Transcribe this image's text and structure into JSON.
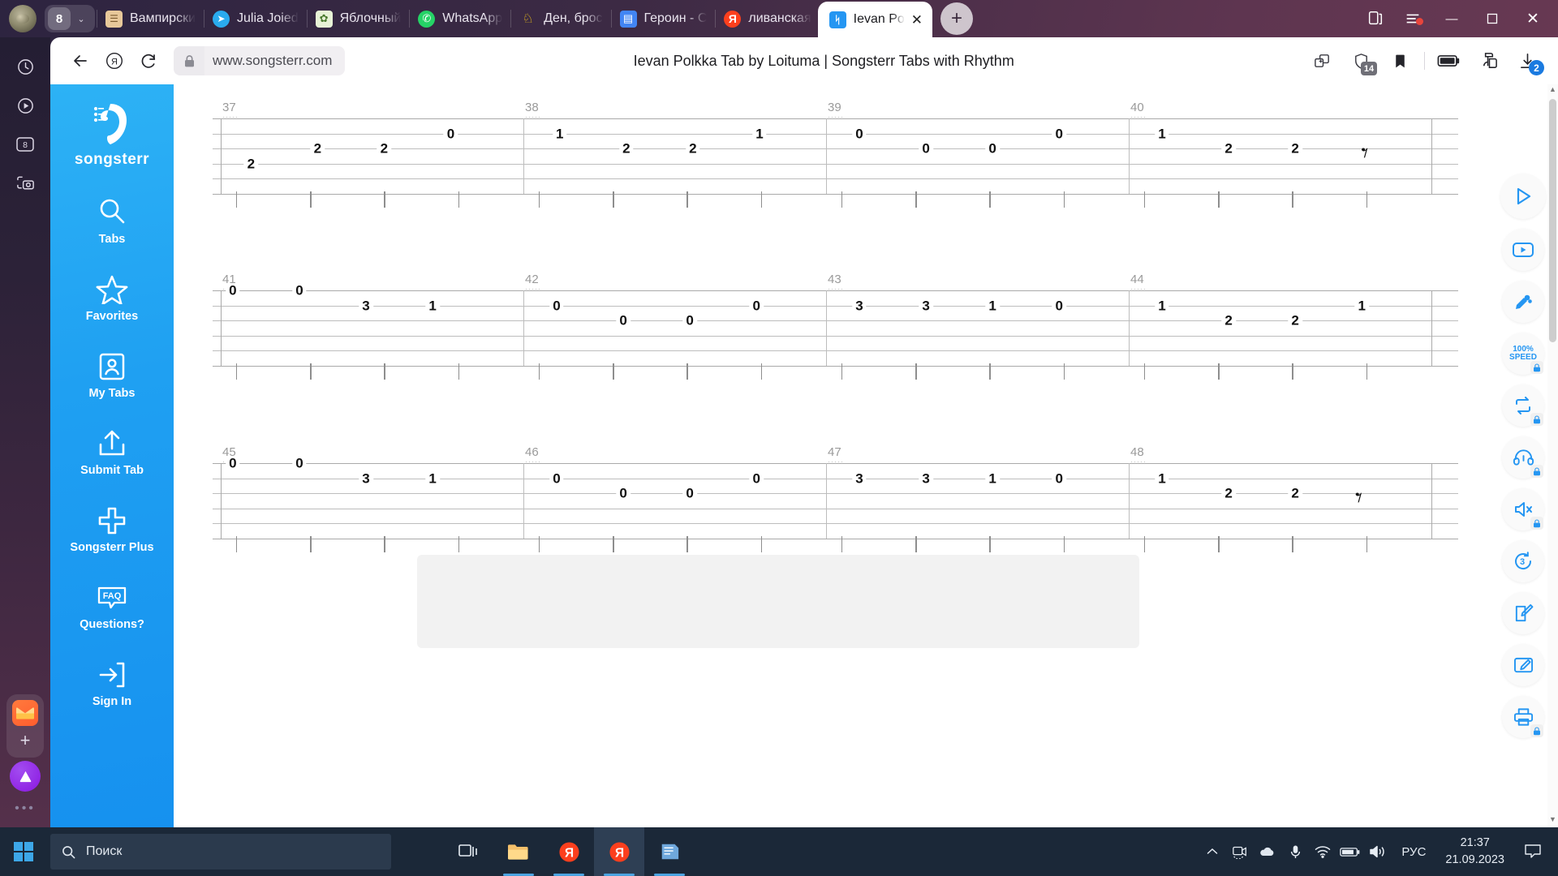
{
  "browser": {
    "session": {
      "count": "8",
      "chevron": "⌄"
    },
    "tabs": [
      {
        "title": "Вампирски",
        "icon": "burger-icon",
        "icon_char": "🍔",
        "color": "#e8c89a"
      },
      {
        "title": "Julia Joied",
        "icon": "telegram-icon",
        "icon_char": "➤",
        "color": "#2aabee"
      },
      {
        "title": "Яблочный",
        "icon": "recipe-icon",
        "icon_char": "🍏",
        "color": "#e7f2d6"
      },
      {
        "title": "WhatsApp",
        "icon": "whatsapp-icon",
        "icon_char": "✆",
        "color": "#25d366"
      },
      {
        "title": "Ден, брос",
        "icon": "fb-page-icon",
        "icon_char": "🧸",
        "color": "#f5c518"
      },
      {
        "title": "Героин - С",
        "icon": "google-docs-icon",
        "icon_char": "▤",
        "color": "#4285f4"
      },
      {
        "title": "ливанская",
        "icon": "yandex-icon",
        "icon_char": "Я",
        "color": "#fc3f1d"
      }
    ],
    "active_tab": {
      "title": "Ievan Po",
      "icon": "songsterr-icon",
      "close": "✕"
    },
    "new_tab_label": "+",
    "window_controls": {
      "minimize": "—",
      "maximize": "▢",
      "close": "✕"
    },
    "toolbar": {
      "back": "←",
      "yandex_home": "Я",
      "reload": "↻",
      "url": "www.songsterr.com",
      "page_title": "Ievan Polkka Tab by Loituma | Songsterr Tabs with Rhythm",
      "right_icons": [
        {
          "name": "split-screen-icon",
          "badge": ""
        },
        {
          "name": "shield-adblock-icon",
          "badge": "14"
        },
        {
          "name": "bookmark-icon",
          "badge": ""
        },
        {
          "name": "battery-saver-icon",
          "badge": ""
        },
        {
          "name": "profile-icon",
          "badge": ""
        },
        {
          "name": "downloads-icon",
          "badge": "2"
        }
      ]
    },
    "edge_sidebar_icons": [
      "history-icon",
      "player-icon",
      "tabs-count-icon",
      "screenshot-icon"
    ],
    "edge_sidebar_tabs_count": "8",
    "edge_more": "•••"
  },
  "site": {
    "brand": "songsterr",
    "nav": [
      {
        "label": "Tabs",
        "icon": "search-icon"
      },
      {
        "label": "Favorites",
        "icon": "star-icon"
      },
      {
        "label": "My Tabs",
        "icon": "user-card-icon"
      },
      {
        "label": "Submit Tab",
        "icon": "upload-icon"
      },
      {
        "label": "Songsterr Plus",
        "icon": "plus-icon"
      },
      {
        "label": "Questions?",
        "icon": "faq-icon"
      },
      {
        "label": "Sign In",
        "icon": "sign-in-icon"
      }
    ],
    "player_rail": [
      {
        "name": "play-button",
        "label": "▶",
        "locked": false
      },
      {
        "name": "video-button",
        "label": "",
        "locked": false
      },
      {
        "name": "mixer-button",
        "label": "",
        "locked": false
      },
      {
        "name": "speed-button",
        "label": "100% SPEED",
        "speed_value": "100%",
        "speed_word": "SPEED",
        "locked": true
      },
      {
        "name": "loop-button",
        "label": "",
        "locked": true
      },
      {
        "name": "metronome-headphones-button",
        "label": "",
        "locked": true
      },
      {
        "name": "mute-button",
        "label": "",
        "locked": true
      },
      {
        "name": "countin-button",
        "label": "3",
        "locked": false
      },
      {
        "name": "notes-button",
        "label": "",
        "locked": false
      },
      {
        "name": "edit-button",
        "label": "",
        "locked": false
      },
      {
        "name": "print-button",
        "label": "",
        "locked": true
      }
    ]
  },
  "tablature": {
    "string_count": 6,
    "systems": [
      {
        "measures": [
          {
            "number": "37",
            "notes": [
              {
                "string": 4,
                "fret": "2",
                "pos": 0.1
              },
              {
                "string": 3,
                "fret": "2",
                "pos": 0.32
              },
              {
                "string": 3,
                "fret": "2",
                "pos": 0.54
              },
              {
                "string": 2,
                "fret": "0",
                "pos": 0.76
              }
            ]
          },
          {
            "number": "38",
            "notes": [
              {
                "string": 2,
                "fret": "1",
                "pos": 0.12
              },
              {
                "string": 3,
                "fret": "2",
                "pos": 0.34
              },
              {
                "string": 3,
                "fret": "2",
                "pos": 0.56
              },
              {
                "string": 2,
                "fret": "1",
                "pos": 0.78
              }
            ]
          },
          {
            "number": "39",
            "notes": [
              {
                "string": 2,
                "fret": "0",
                "pos": 0.11
              },
              {
                "string": 3,
                "fret": "0",
                "pos": 0.33
              },
              {
                "string": 3,
                "fret": "0",
                "pos": 0.55
              },
              {
                "string": 2,
                "fret": "0",
                "pos": 0.77
              }
            ]
          },
          {
            "number": "40",
            "notes": [
              {
                "string": 2,
                "fret": "1",
                "pos": 0.11
              },
              {
                "string": 3,
                "fret": "2",
                "pos": 0.33
              },
              {
                "string": 3,
                "fret": "2",
                "pos": 0.55
              }
            ],
            "rest": {
              "string": 3,
              "pos": 0.78
            }
          }
        ]
      },
      {
        "measures": [
          {
            "number": "41",
            "notes": [
              {
                "string": 1,
                "fret": "0",
                "pos": 0.04
              },
              {
                "string": 1,
                "fret": "0",
                "pos": 0.26
              },
              {
                "string": 2,
                "fret": "3",
                "pos": 0.48
              },
              {
                "string": 2,
                "fret": "1",
                "pos": 0.7
              }
            ]
          },
          {
            "number": "42",
            "notes": [
              {
                "string": 2,
                "fret": "0",
                "pos": 0.11
              },
              {
                "string": 3,
                "fret": "0",
                "pos": 0.33
              },
              {
                "string": 3,
                "fret": "0",
                "pos": 0.55
              },
              {
                "string": 2,
                "fret": "0",
                "pos": 0.77
              }
            ]
          },
          {
            "number": "43",
            "notes": [
              {
                "string": 2,
                "fret": "3",
                "pos": 0.11
              },
              {
                "string": 2,
                "fret": "3",
                "pos": 0.33
              },
              {
                "string": 2,
                "fret": "1",
                "pos": 0.55
              },
              {
                "string": 2,
                "fret": "0",
                "pos": 0.77
              }
            ]
          },
          {
            "number": "44",
            "notes": [
              {
                "string": 2,
                "fret": "1",
                "pos": 0.11
              },
              {
                "string": 3,
                "fret": "2",
                "pos": 0.33
              },
              {
                "string": 3,
                "fret": "2",
                "pos": 0.55
              },
              {
                "string": 2,
                "fret": "1",
                "pos": 0.77
              }
            ]
          }
        ]
      },
      {
        "measures": [
          {
            "number": "45",
            "notes": [
              {
                "string": 1,
                "fret": "0",
                "pos": 0.04
              },
              {
                "string": 1,
                "fret": "0",
                "pos": 0.26
              },
              {
                "string": 2,
                "fret": "3",
                "pos": 0.48
              },
              {
                "string": 2,
                "fret": "1",
                "pos": 0.7
              }
            ]
          },
          {
            "number": "46",
            "notes": [
              {
                "string": 2,
                "fret": "0",
                "pos": 0.11
              },
              {
                "string": 3,
                "fret": "0",
                "pos": 0.33
              },
              {
                "string": 3,
                "fret": "0",
                "pos": 0.55
              },
              {
                "string": 2,
                "fret": "0",
                "pos": 0.77
              }
            ]
          },
          {
            "number": "47",
            "notes": [
              {
                "string": 2,
                "fret": "3",
                "pos": 0.11
              },
              {
                "string": 2,
                "fret": "3",
                "pos": 0.33
              },
              {
                "string": 2,
                "fret": "1",
                "pos": 0.55
              },
              {
                "string": 2,
                "fret": "0",
                "pos": 0.77
              }
            ]
          },
          {
            "number": "48",
            "notes": [
              {
                "string": 2,
                "fret": "1",
                "pos": 0.11
              },
              {
                "string": 3,
                "fret": "2",
                "pos": 0.33
              },
              {
                "string": 3,
                "fret": "2",
                "pos": 0.55
              }
            ],
            "rest": {
              "string": 3,
              "pos": 0.76
            }
          }
        ]
      }
    ]
  },
  "taskbar": {
    "search_placeholder": "Поиск",
    "apps": [
      {
        "name": "task-view-icon",
        "active": false
      },
      {
        "name": "file-explorer-icon",
        "active": false,
        "running": true
      },
      {
        "name": "yandex-browser-icon",
        "active": false,
        "running": true
      },
      {
        "name": "yandex-browser-icon-2",
        "active": true,
        "running": true
      },
      {
        "name": "notepad-icon",
        "active": false,
        "running": true
      }
    ],
    "tray": {
      "overflow": "^",
      "icons": [
        "camera-icon",
        "onedrive-icon",
        "microphone-icon",
        "wifi-icon",
        "battery-icon",
        "volume-icon"
      ],
      "language": "РУС",
      "time": "21:37",
      "date": "21.09.2023",
      "notifications": "notification-icon"
    }
  },
  "colors": {
    "songsterr_blue": "#2596f2",
    "browser_chrome": "#3c2a44",
    "taskbar": "#1b2838",
    "accent_badge": "#1a7ae0"
  }
}
